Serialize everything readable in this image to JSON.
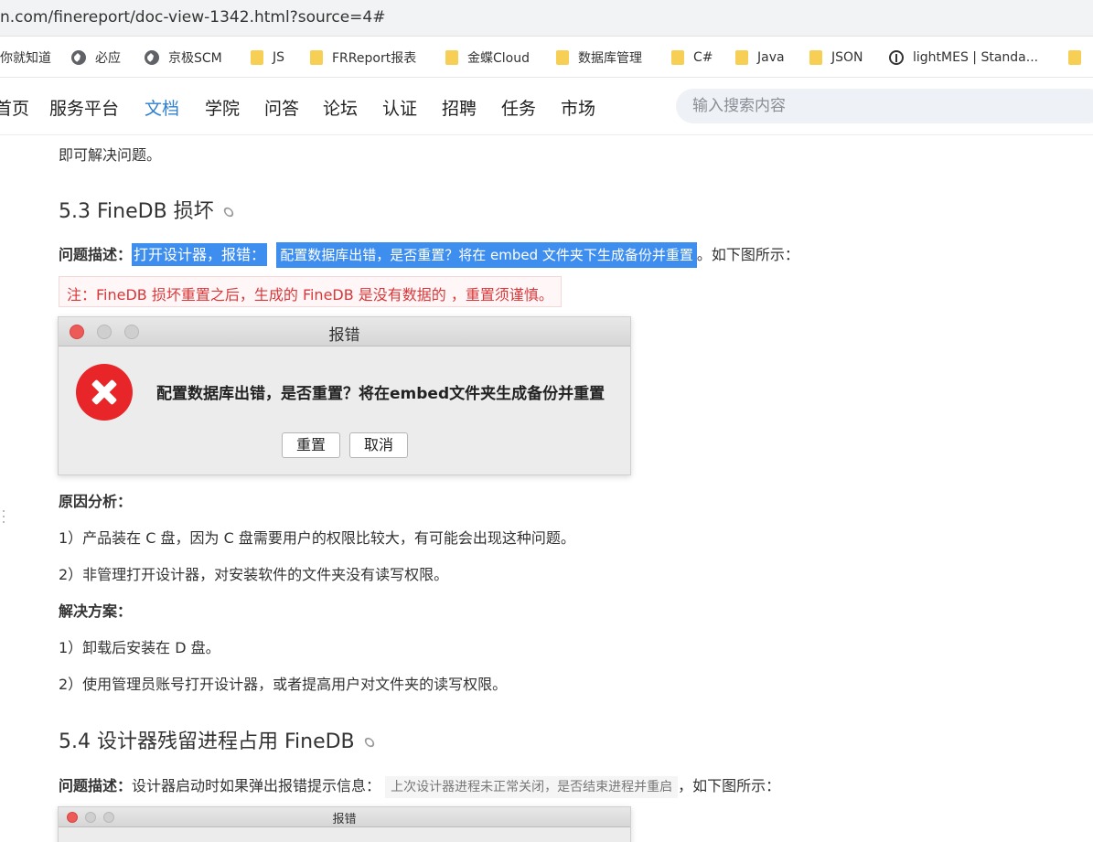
{
  "browser": {
    "url": "n.com/finereport/doc-view-1342.html?source=4#",
    "bookmarks": [
      {
        "label": "你就知道",
        "icon": "none"
      },
      {
        "label": "必应",
        "icon": "globe-icon"
      },
      {
        "label": "京极SCM",
        "icon": "globe-icon"
      },
      {
        "label": "JS",
        "icon": "folder-icon"
      },
      {
        "label": "FRReport报表",
        "icon": "folder-icon"
      },
      {
        "label": "金蝶Cloud",
        "icon": "folder-icon"
      },
      {
        "label": "数据库管理",
        "icon": "folder-icon"
      },
      {
        "label": "C#",
        "icon": "folder-icon"
      },
      {
        "label": "Java",
        "icon": "folder-icon"
      },
      {
        "label": "JSON",
        "icon": "folder-icon"
      },
      {
        "label": "lightMES | Standa...",
        "icon": "info-icon"
      },
      {
        "label": "",
        "icon": "folder-icon"
      }
    ]
  },
  "nav": {
    "items": [
      "首页",
      "服务平台",
      "文档",
      "学院",
      "问答",
      "论坛",
      "认证",
      "招聘",
      "任务",
      "市场"
    ],
    "active_index": 2,
    "active_color": "#2f80d1",
    "search_placeholder": "输入搜索内容"
  },
  "article": {
    "intro_tail": "即可解决问题。",
    "s53": {
      "heading": "5.3 FineDB 损坏",
      "desc_label": "问题描述：",
      "desc_highlight1": "打开设计器，报错：",
      "desc_highlight2": "配置数据库出错，是否重置？将在 embed 文件夹下生成备份并重置",
      "desc_tail": "。如下图所示：",
      "note": "注：FineDB 损坏重置之后，生成的 FineDB 是没有数据的 ，重置须谨慎。",
      "dialog": {
        "title": "报错",
        "message": "配置数据库出错，是否重置？将在embed文件夹生成备份并重置",
        "btn_reset": "重置",
        "btn_cancel": "取消"
      },
      "cause_label": "原因分析：",
      "cause1": "1）产品装在 C 盘，因为 C 盘需要用户的权限比较大，有可能会出现这种问题。",
      "cause2": "2）非管理打开设计器，对安装软件的文件夹没有读写权限。",
      "solution_label": "解决方案：",
      "solution1": "1）卸载后安装在 D 盘。",
      "solution2": "2）使用管理员账号打开设计器，或者提高用户对文件夹的读写权限。"
    },
    "s54": {
      "heading": "5.4 设计器残留进程占用 FineDB",
      "desc_label": "问题描述：",
      "desc_text": "设计器启动时如果弹出报错提示信息：",
      "desc_code": "上次设计器进程未正常关闭，是否结束进程并重启",
      "desc_tail": "，如下图所示：",
      "dialog_title": "报错"
    }
  }
}
